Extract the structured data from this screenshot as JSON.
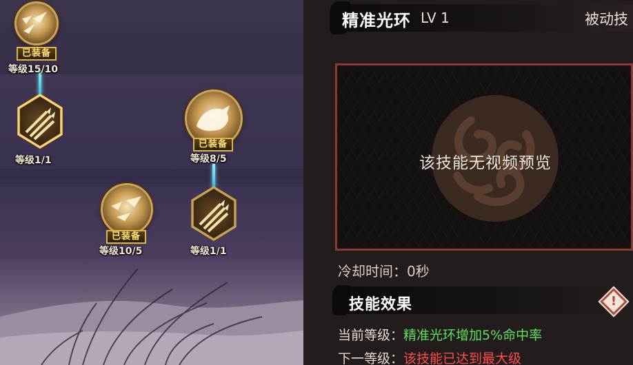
{
  "skill_tree": {
    "nodes": [
      {
        "id": "top",
        "equipped_label": "已装备",
        "level_text": "等级15/10"
      },
      {
        "id": "hex-left",
        "equipped_label": "",
        "level_text": "等级1/1"
      },
      {
        "id": "wolf",
        "equipped_label": "已装备",
        "level_text": "等级8/5"
      },
      {
        "id": "birds",
        "equipped_label": "已装备",
        "level_text": "等级10/5"
      },
      {
        "id": "hex-right",
        "equipped_label": "",
        "level_text": "等级1/1"
      }
    ]
  },
  "detail": {
    "skill_name": "精准光环",
    "skill_level": "LV 1",
    "skill_type": "被动技",
    "preview_text": "该技能无视频预览",
    "cooldown": "冷却时间：0秒",
    "effect_title": "技能效果",
    "info_icon": "!",
    "current_label": "当前等级：",
    "current_value": "精准光环增加5%命中率",
    "next_label": "下一等级：",
    "next_value": "该技能已达到最大级"
  },
  "colors": {
    "equipped_gold": "#ffe07a",
    "current_value_green": "#5ee05a",
    "next_value_red": "#ff4b4b",
    "preview_border": "#8a3a36"
  }
}
